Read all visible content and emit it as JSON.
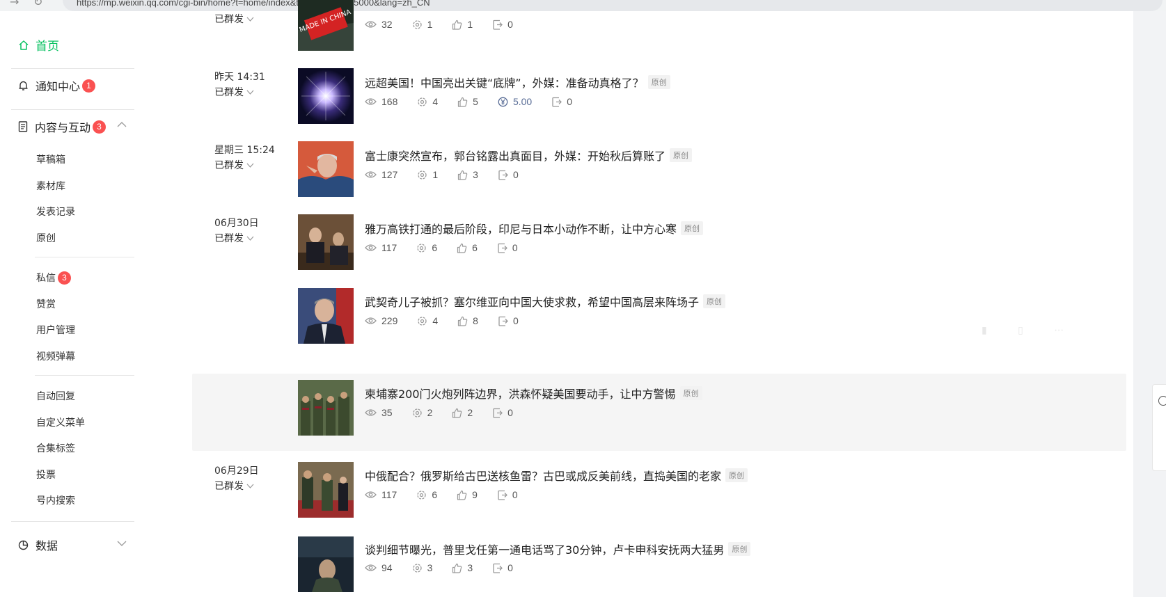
{
  "browser": {
    "url": "https://mp.weixin.qq.com/cgi-bin/home?t=home/index&token=2096985000&lang=zh_CN"
  },
  "sidebar": {
    "home": "首页",
    "notifications": {
      "label": "通知中心",
      "badge": "1"
    },
    "content": {
      "label": "内容与互动",
      "badge": "3"
    },
    "content_items": [
      "草稿箱",
      "素材库",
      "发表记录",
      "原创"
    ],
    "interact_items": [
      {
        "label": "私信",
        "badge": "3"
      },
      {
        "label": "赞赏"
      },
      {
        "label": "用户管理"
      },
      {
        "label": "视频弹幕"
      }
    ],
    "function_items": [
      "自动回复",
      "自定义菜单",
      "合集标签",
      "投票",
      "号内搜索"
    ],
    "data": {
      "label": "数据"
    }
  },
  "colors": {
    "accent": "#07c160",
    "badge": "#fa5151",
    "money": "#576b95"
  },
  "published_state": "已群发",
  "articles": [
    {
      "date": "",
      "show_state": true,
      "title": "",
      "tag": "",
      "views": "32",
      "shares": "1",
      "likes": "1",
      "money": "",
      "forwards": "0",
      "thumb_text": "MADE IN CHINA"
    },
    {
      "date": "昨天 14:31",
      "show_state": true,
      "title": "远超美国！中国亮出关键“底牌”，外媒：准备动真格了？",
      "tag": "原创",
      "views": "168",
      "shares": "4",
      "likes": "5",
      "money": "5.00",
      "forwards": "0"
    },
    {
      "date": "星期三 15:24",
      "show_state": true,
      "title": "富士康突然宣布，郭台铭露出真面目，外媒：开始秋后算账了",
      "tag": "原创",
      "views": "127",
      "shares": "1",
      "likes": "3",
      "money": "",
      "forwards": "0"
    },
    {
      "date": "06月30日",
      "show_state": true,
      "title": "雅万高铁打通的最后阶段，印尼与日本小动作不断，让中方心寒",
      "tag": "原创",
      "views": "117",
      "shares": "6",
      "likes": "6",
      "money": "",
      "forwards": "0"
    },
    {
      "date": "",
      "show_state": false,
      "title": "武契奇儿子被抓？塞尔维亚向中国大使求救，希望中国高层来阵场子",
      "tag": "原创",
      "views": "229",
      "shares": "4",
      "likes": "8",
      "money": "",
      "forwards": "0"
    },
    {
      "date": "",
      "show_state": false,
      "title": "柬埔寨200门火炮列阵边界，洪森怀疑美国要动手，让中方警惕",
      "tag": "原创",
      "views": "35",
      "shares": "2",
      "likes": "2",
      "money": "",
      "forwards": "0"
    },
    {
      "date": "06月29日",
      "show_state": true,
      "title": "中俄配合？俄罗斯给古巴送核鱼雷？古巴或成反美前线，直捣美国的老家",
      "tag": "原创",
      "views": "117",
      "shares": "6",
      "likes": "9",
      "money": "",
      "forwards": "0"
    },
    {
      "date": "",
      "show_state": false,
      "title": "谈判细节曝光，普里戈任第一通电话骂了30分钟，卢卡申科安抚两大猛男",
      "tag": "原创",
      "views": "94",
      "shares": "3",
      "likes": "3",
      "money": "",
      "forwards": "0"
    }
  ]
}
